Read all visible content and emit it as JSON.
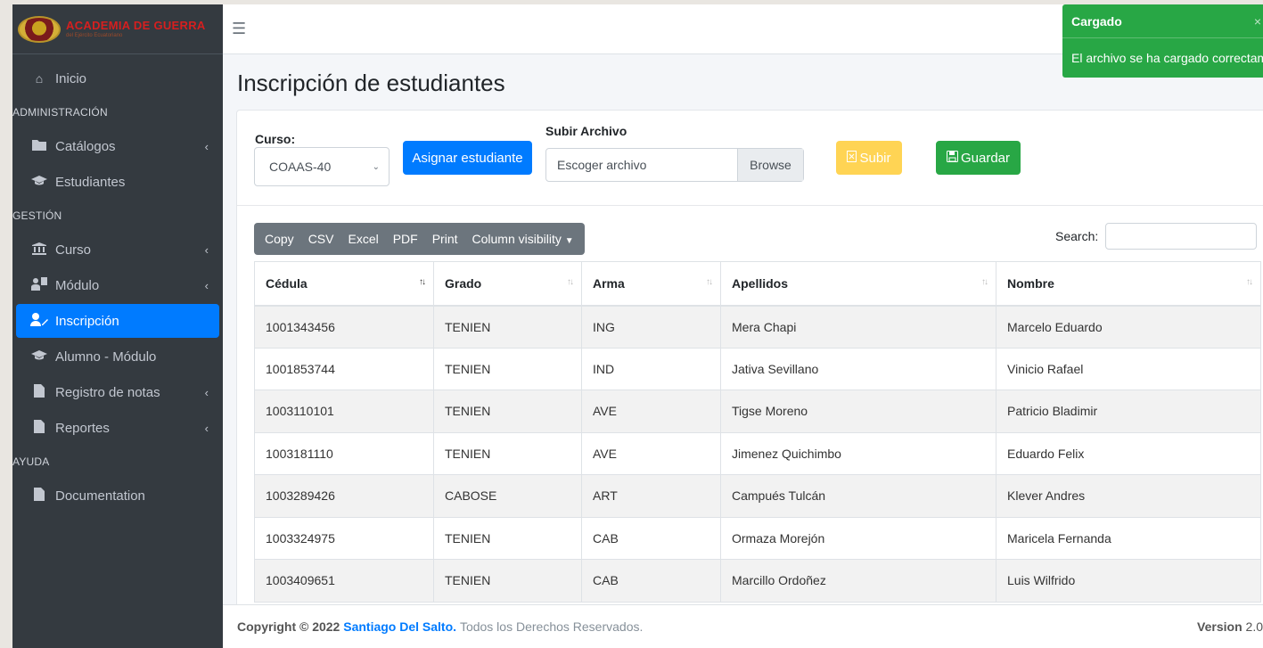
{
  "brand": {
    "title": "ACADEMIA DE GUERRA",
    "subtitle": "del Ejército Ecuatoriano"
  },
  "sidebar": {
    "items": [
      {
        "label": "Inicio",
        "icon": "home-icon"
      },
      {
        "header": "ADMINISTRACIÓN"
      },
      {
        "label": "Catálogos",
        "icon": "folder-icon",
        "caret": "‹"
      },
      {
        "label": "Estudiantes",
        "icon": "graduation-cap-icon"
      },
      {
        "header": "GESTIÓN"
      },
      {
        "label": "Curso",
        "icon": "institution-icon",
        "caret": "‹"
      },
      {
        "label": "Módulo",
        "icon": "chalkboard-teacher-icon",
        "caret": "‹"
      },
      {
        "label": "Inscripción",
        "icon": "user-edit-icon",
        "active": true
      },
      {
        "label": "Alumno - Módulo",
        "icon": "graduation-cap-icon"
      },
      {
        "label": "Registro de notas",
        "icon": "file-icon",
        "caret": "‹"
      },
      {
        "label": "Reportes",
        "icon": "file-icon",
        "caret": "‹"
      },
      {
        "header": "AYUDA"
      },
      {
        "label": "Documentation",
        "icon": "file-icon"
      }
    ]
  },
  "page": {
    "title": "Inscripción de estudiantes"
  },
  "form": {
    "curso_label": "Curso:",
    "curso_value": "COAAS-40",
    "assign_button": "Asignar estudiante",
    "upload_label": "Subir Archivo",
    "file_placeholder": "Escoger archivo",
    "browse_label": "Browse",
    "upload_button": "Subir",
    "save_button": "Guardar"
  },
  "table_tools": {
    "buttons": [
      "Copy",
      "CSV",
      "Excel",
      "PDF",
      "Print",
      "Column visibility"
    ],
    "search_label": "Search:"
  },
  "table": {
    "columns": [
      "Cédula",
      "Grado",
      "Arma",
      "Apellidos",
      "Nombre"
    ],
    "rows": [
      [
        "1001343456",
        "TENIEN",
        "ING",
        "Mera Chapi",
        "Marcelo Eduardo"
      ],
      [
        "1001853744",
        "TENIEN",
        "IND",
        "Jativa Sevillano",
        "Vinicio Rafael"
      ],
      [
        "1003110101",
        "TENIEN",
        "AVE",
        "Tigse Moreno",
        "Patricio Bladimir"
      ],
      [
        "1003181110",
        "TENIEN",
        "AVE",
        "Jimenez Quichimbo",
        "Eduardo Felix"
      ],
      [
        "1003289426",
        "CABOSE",
        "ART",
        "Campués Tulcán",
        "Klever Andres"
      ],
      [
        "1003324975",
        "TENIEN",
        "CAB",
        "Ormaza Morejón",
        "Maricela Fernanda"
      ],
      [
        "1003409651",
        "TENIEN",
        "CAB",
        "Marcillo Ordoñez",
        "Luis Wilfrido"
      ]
    ]
  },
  "footer": {
    "copyright": "Copyright © 2022",
    "author": "Santiago Del Salto.",
    "rights": "Todos los Derechos Reservados.",
    "version_label": "Version",
    "version_value": "2.0"
  },
  "toast": {
    "title": "Cargado",
    "message": "El archivo se ha cargado correctamente",
    "close": "×"
  },
  "colors": {
    "primary": "#007bff",
    "success": "#28a745",
    "warning": "#ffd454",
    "sidebar": "#343a40"
  }
}
